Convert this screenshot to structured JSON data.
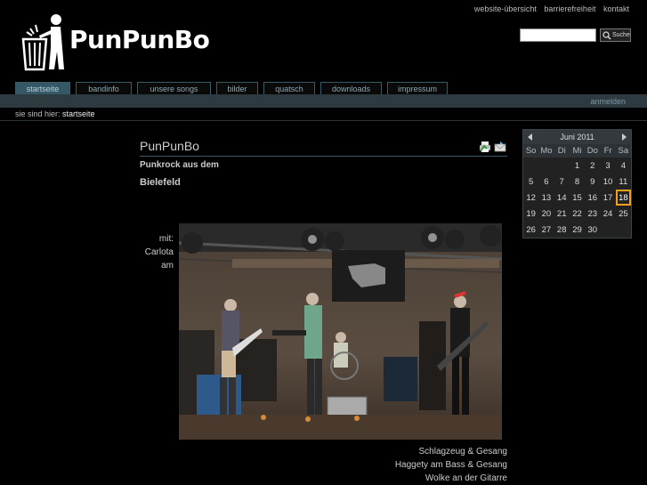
{
  "header": {
    "top_links": [
      "website-übersicht",
      "barrierefreiheit",
      "kontakt"
    ],
    "logo_text": "PunPunBo",
    "search": {
      "placeholder": "",
      "button_label": "Suche"
    }
  },
  "nav": {
    "tabs": [
      {
        "label": "startseite",
        "active": true
      },
      {
        "label": "bandinfo",
        "active": false
      },
      {
        "label": "unsere songs",
        "active": false
      },
      {
        "label": "bilder",
        "active": false
      },
      {
        "label": "quatsch",
        "active": false
      },
      {
        "label": "downloads",
        "active": false
      },
      {
        "label": "impressum",
        "active": false
      }
    ],
    "login_label": "anmelden"
  },
  "breadcrumb": {
    "prefix": "sie sind hier:",
    "current": "startseite"
  },
  "article": {
    "title": "PunPunBo",
    "subtitle_line1": "Punkrock aus dem",
    "subtitle_line2": "Bielefeld",
    "caption_left": [
      "mit:",
      "Carlota",
      "am"
    ],
    "caption_bottom": [
      "Schlagzeug & Gesang",
      "Haggety am Bass & Gesang",
      "Wolke an der Gitarre"
    ]
  },
  "calendar": {
    "month_label": "Juni 2011",
    "weekdays": [
      "So",
      "Mo",
      "Di",
      "Mi",
      "Do",
      "Fr",
      "Sa"
    ],
    "weeks": [
      [
        "",
        "",
        "",
        "1",
        "2",
        "3",
        "4"
      ],
      [
        "5",
        "6",
        "7",
        "8",
        "9",
        "10",
        "11"
      ],
      [
        "12",
        "13",
        "14",
        "15",
        "16",
        "17",
        "18"
      ],
      [
        "19",
        "20",
        "21",
        "22",
        "23",
        "24",
        "25"
      ],
      [
        "26",
        "27",
        "28",
        "29",
        "30",
        "",
        ""
      ]
    ],
    "today": "18"
  },
  "colors": {
    "accent": "#355866",
    "today_highlight": "#f0a020"
  }
}
